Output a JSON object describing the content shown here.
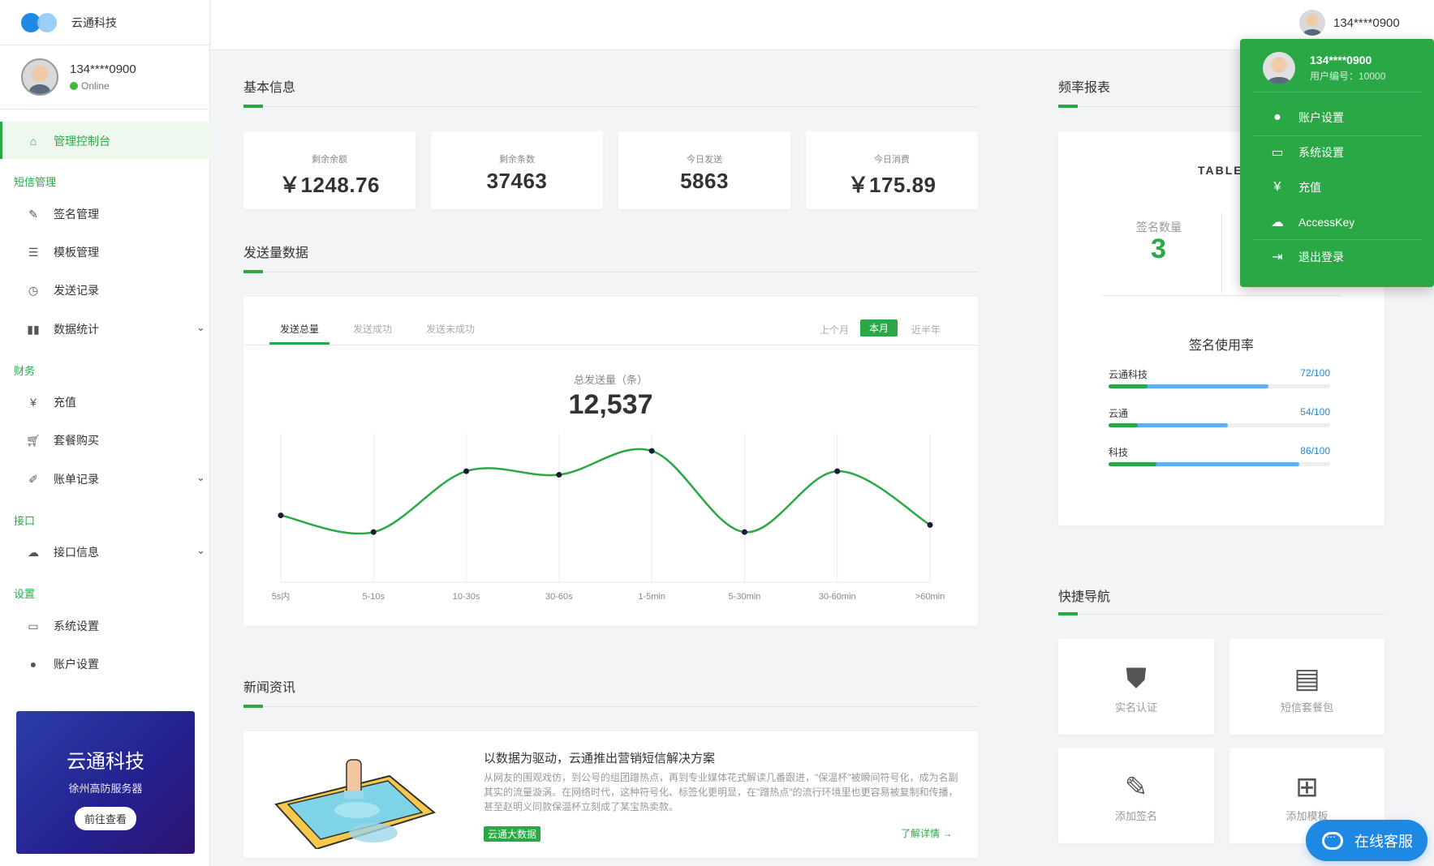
{
  "app": {
    "name": "云通科技"
  },
  "user": {
    "phone": "134****0900",
    "status": "Online",
    "user_id_label": "用户编号：10000"
  },
  "sidebar": {
    "active": {
      "label": "管理控制台",
      "icon": "home-icon"
    },
    "sections": [
      {
        "title": "短信管理",
        "items": [
          {
            "label": "签名管理",
            "icon": "pencil-icon"
          },
          {
            "label": "模板管理",
            "icon": "list-icon"
          },
          {
            "label": "发送记录",
            "icon": "clock-icon"
          },
          {
            "label": "数据统计",
            "icon": "bar-chart-icon",
            "expandable": true
          }
        ]
      },
      {
        "title": "财务",
        "items": [
          {
            "label": "充值",
            "icon": "yen-icon"
          },
          {
            "label": "套餐购买",
            "icon": "cart-icon"
          },
          {
            "label": "账单记录",
            "icon": "edit-icon",
            "expandable": true
          }
        ]
      },
      {
        "title": "接口",
        "items": [
          {
            "label": "接口信息",
            "icon": "cloud-icon",
            "expandable": true
          }
        ]
      },
      {
        "title": "设置",
        "items": [
          {
            "label": "系统设置",
            "icon": "monitor-icon"
          },
          {
            "label": "账户设置",
            "icon": "user-icon"
          }
        ]
      }
    ],
    "banner": {
      "title": "云通科技",
      "subtitle": "徐州高防服务器",
      "button": "前往查看"
    }
  },
  "basic": {
    "title": "基本信息",
    "stats": [
      {
        "label": "剩余余额",
        "value": "￥1248.76"
      },
      {
        "label": "剩余条数",
        "value": "37463"
      },
      {
        "label": "今日发送",
        "value": "5863"
      },
      {
        "label": "今日消费",
        "value": "￥175.89"
      }
    ]
  },
  "send_data": {
    "title": "发送量数据",
    "tabs": [
      "发送总量",
      "发送成功",
      "发送未成功"
    ],
    "active_tab": 0,
    "ranges": [
      "上个月",
      "本月",
      "近半年"
    ],
    "active_range": 1,
    "total_label": "总发送量（条）",
    "total_value": "12,537"
  },
  "chart_data": {
    "type": "line",
    "categories": [
      "5s内",
      "5-10s",
      "10-30s",
      "30-60s",
      "1-5min",
      "5-30min",
      "30-60min",
      ">60min"
    ],
    "series": [
      {
        "values": [
          560,
          420,
          930,
          900,
          1100,
          420,
          930,
          480
        ]
      }
    ],
    "ylim": [
      0,
      1250
    ],
    "color": "#2aa845",
    "grid": "vertical"
  },
  "news": {
    "title": "新闻资讯",
    "item": {
      "headline": "以数据为驱动，云通推出营销短信解决方案",
      "body": "从网友的围观戏仿，到公号的组团蹭热点，再到专业媒体花式解读几番跟进，\"保温杯\"被瞬间符号化，成为名副其实的流量漩涡。在网络时代，这种符号化、标签化更明显，在\"蹭热点\"的流行环境里也更容易被复制和传播，甚至赵明义同款保温杯立刻成了某宝热卖款。",
      "tag": "云通大数据",
      "more": "了解详情"
    }
  },
  "report": {
    "title": "频率报表",
    "table_label": "TABLE",
    "sign_count_label": "签名数量",
    "sign_count": "3",
    "usage_title": "签名使用率",
    "usage": [
      {
        "name": "云通科技",
        "value": 72,
        "max": 100,
        "text": "72/100"
      },
      {
        "name": "云通",
        "value": 54,
        "max": 100,
        "text": "54/100"
      },
      {
        "name": "科技",
        "value": 86,
        "max": 100,
        "text": "86/100"
      }
    ]
  },
  "quick_nav": {
    "title": "快捷导航",
    "items": [
      {
        "label": "实名认证",
        "icon": "shield-icon"
      },
      {
        "label": "短信套餐包",
        "icon": "message-icon"
      },
      {
        "label": "添加签名",
        "icon": "edit-square-icon"
      },
      {
        "label": "添加模板",
        "icon": "layout-icon"
      }
    ]
  },
  "dropdown": {
    "items": [
      {
        "label": "账户设置",
        "icon": "user-icon"
      },
      {
        "label": "系统设置",
        "icon": "monitor-icon"
      },
      {
        "label": "充值",
        "icon": "yen-icon"
      },
      {
        "label": "AccessKey",
        "icon": "cloud-icon"
      },
      {
        "label": "退出登录",
        "icon": "logout-icon"
      }
    ]
  },
  "support": {
    "label": "在线客服"
  },
  "colors": {
    "accent": "#2aa845",
    "blue": "#1e88e5"
  }
}
